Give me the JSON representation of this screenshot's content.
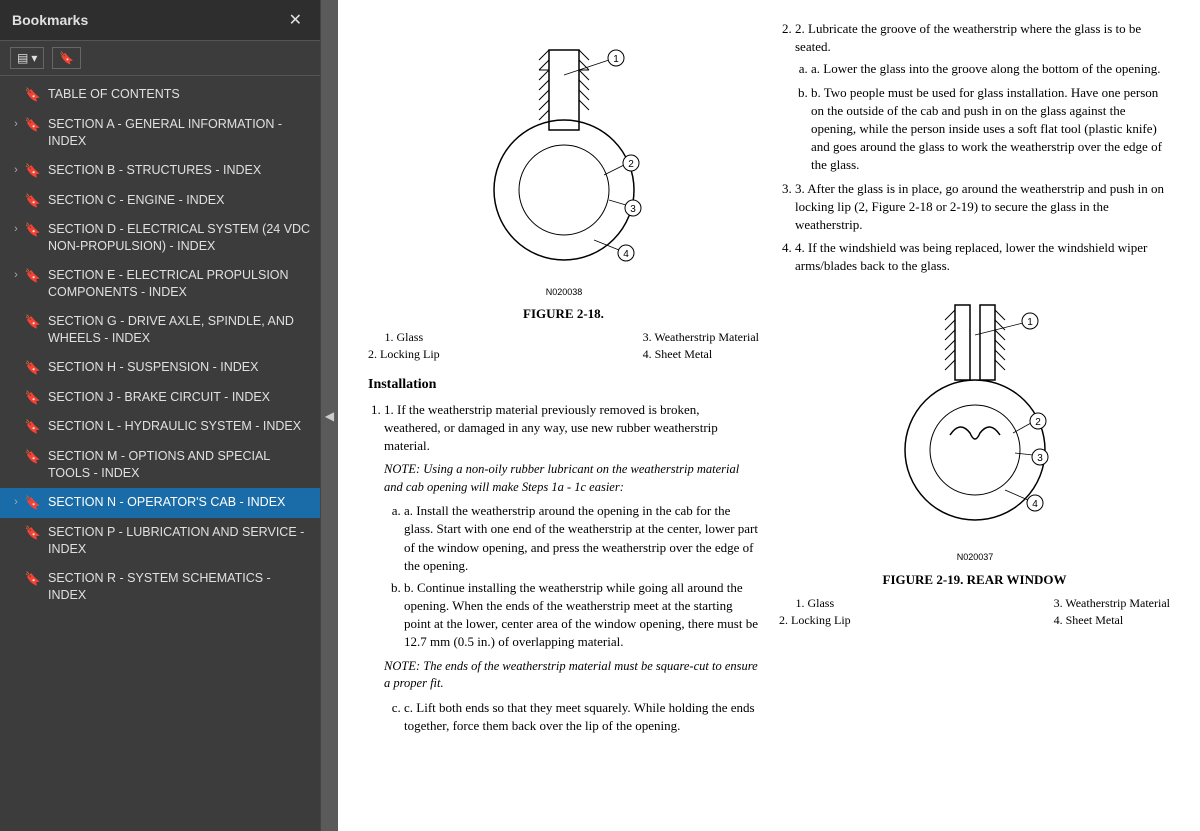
{
  "sidebar": {
    "title": "Bookmarks",
    "close_label": "✕",
    "toolbar": {
      "view_btn": "▤ ▾",
      "search_icon": "🔖"
    },
    "items": [
      {
        "id": "toc",
        "label": "TABLE OF CONTENTS",
        "has_arrow": false,
        "active": false
      },
      {
        "id": "sec-a",
        "label": "SECTION A - GENERAL INFORMATION - INDEX",
        "has_arrow": true,
        "active": false
      },
      {
        "id": "sec-b",
        "label": "SECTION B - STRUCTURES - INDEX",
        "has_arrow": true,
        "active": false
      },
      {
        "id": "sec-c",
        "label": "SECTION C - ENGINE - INDEX",
        "has_arrow": false,
        "active": false
      },
      {
        "id": "sec-d",
        "label": "SECTION D - ELECTRICAL SYSTEM (24 VDC NON-PROPULSION) - INDEX",
        "has_arrow": true,
        "active": false
      },
      {
        "id": "sec-e",
        "label": "SECTION E - ELECTRICAL PROPULSION COMPONENTS - INDEX",
        "has_arrow": true,
        "active": false
      },
      {
        "id": "sec-g",
        "label": "SECTION G - DRIVE AXLE, SPINDLE, AND WHEELS - INDEX",
        "has_arrow": false,
        "active": false
      },
      {
        "id": "sec-h",
        "label": "SECTION H - SUSPENSION - INDEX",
        "has_arrow": false,
        "active": false
      },
      {
        "id": "sec-j",
        "label": "SECTION J - BRAKE CIRCUIT - INDEX",
        "has_arrow": false,
        "active": false
      },
      {
        "id": "sec-l",
        "label": "SECTION L - HYDRAULIC SYSTEM - INDEX",
        "has_arrow": false,
        "active": false
      },
      {
        "id": "sec-m",
        "label": "SECTION M - OPTIONS AND SPECIAL TOOLS - INDEX",
        "has_arrow": false,
        "active": false
      },
      {
        "id": "sec-n",
        "label": "SECTION N - OPERATOR'S CAB - INDEX",
        "has_arrow": true,
        "active": true
      },
      {
        "id": "sec-p",
        "label": "SECTION P - LUBRICATION AND SERVICE - INDEX",
        "has_arrow": false,
        "active": false
      },
      {
        "id": "sec-r",
        "label": "SECTION R - SYSTEM SCHEMATICS - INDEX",
        "has_arrow": false,
        "active": false
      }
    ]
  },
  "document": {
    "figures": {
      "fig18": {
        "caption": "FIGURE 2-18.",
        "labels": {
          "l1": "1. Glass",
          "l2": "2. Locking Lip",
          "l3": "3. Weatherstrip Material",
          "l4": "4. Sheet Metal"
        },
        "ref": "N020038"
      },
      "fig19": {
        "caption": "FIGURE 2-19. REAR WINDOW",
        "labels": {
          "l1": "1. Glass",
          "l2": "2. Locking Lip",
          "l3": "3. Weatherstrip Material",
          "l4": "4. Sheet Metal"
        },
        "ref": "N020037"
      }
    },
    "right_text": {
      "item2": "2. Lubricate the groove of the weatherstrip where the glass is to be seated.",
      "item2a": "a. Lower the glass into the groove along the bottom of the opening.",
      "item2b": "b. Two people must be used for glass installation. Have one person on the outside of the cab and push in on the glass against the opening, while the person inside uses a soft flat tool (plastic knife) and goes around the glass to work the weatherstrip over the edge of the glass.",
      "item3": "3. After the glass is in place, go around the weatherstrip and push in on locking lip (2, Figure 2-18 or 2-19) to secure the glass in the weatherstrip.",
      "item4": "4. If the windshield was being replaced, lower the windshield wiper arms/blades back to the glass."
    },
    "installation": {
      "title": "Installation",
      "item1": "1. If the weatherstrip material previously removed is broken, weathered, or damaged in any way, use new rubber weatherstrip material.",
      "note1": "NOTE: Using a non-oily rubber lubricant on the weatherstrip material and cab opening will make Steps 1a - 1c easier:",
      "item1a": "a. Install the weatherstrip around the opening in the cab for the glass. Start with one end of the weatherstrip at the center, lower part of the window opening, and press the weatherstrip over the edge of the opening.",
      "item1b": "b. Continue installing the weatherstrip while going all around the opening. When the ends of the weatherstrip meet at the starting point at the lower, center area of the window opening, there must be 12.7 mm (0.5 in.) of overlapping material.",
      "note2": "NOTE: The ends of the weatherstrip material must be square-cut to ensure a proper fit.",
      "item1c": "c. Lift both ends so that they meet squarely. While holding the ends together, force them back over the lip of the opening."
    }
  }
}
